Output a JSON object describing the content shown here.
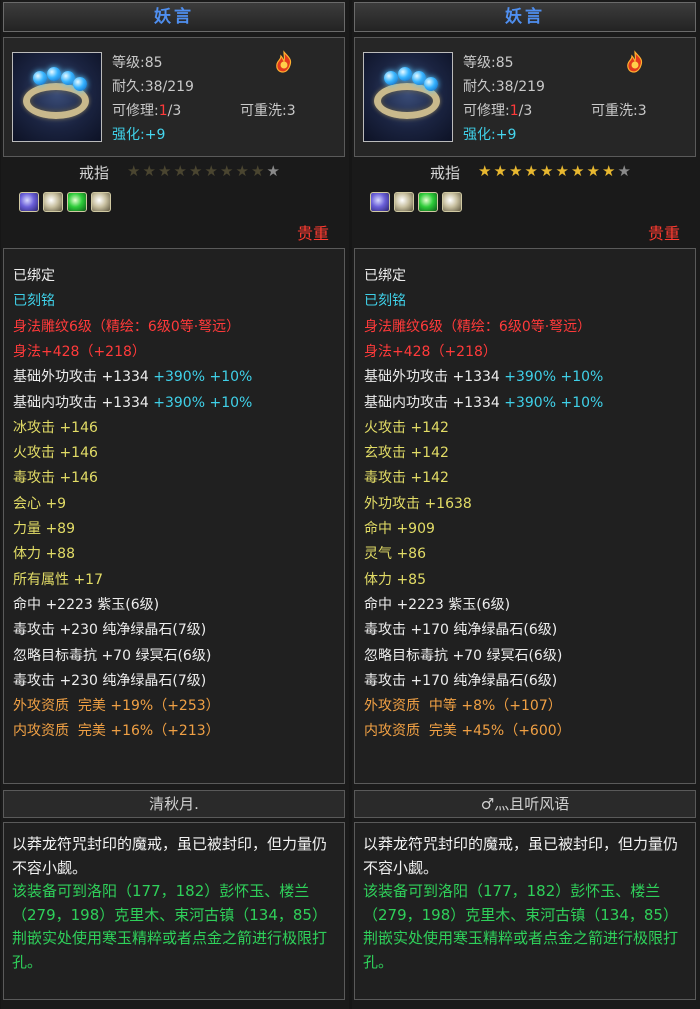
{
  "colors": {
    "title_blue": "#4f8ff0",
    "red": "#ff3a3a",
    "cyan": "#3fd0e8",
    "yellow": "#e2dc66",
    "orange": "#f0a044",
    "white": "#ededed",
    "green": "#2fd05a"
  },
  "panels": [
    {
      "title": "妖言",
      "level": "等级:85",
      "durability": "耐久:38/219",
      "repair_label": "可修理:",
      "repair_used": "1",
      "repair_total": "/3",
      "reset": "可重洗:3",
      "enhance_label": "强化:",
      "enhance_value": "+9",
      "type_name": "戒指",
      "stars_filled": 0,
      "stars_total": 10,
      "gem_slots": [
        "purple-gem-icon",
        "white-gem-icon",
        "green-gem-icon",
        "white-gem-icon"
      ],
      "quality": "贵重",
      "attributes": [
        {
          "segments": [
            {
              "t": "已绑定",
              "c": "white"
            }
          ]
        },
        {
          "segments": [
            {
              "t": "已刻铭",
              "c": "cyan"
            }
          ]
        },
        {
          "segments": [
            {
              "t": "身法雕纹6级（精绘：6级0等·弩远）",
              "c": "red"
            }
          ]
        },
        {
          "segments": [
            {
              "t": "身法+428（+218）",
              "c": "red"
            }
          ]
        },
        {
          "segments": [
            {
              "t": "基础外功攻击 +1334 ",
              "c": "white"
            },
            {
              "t": "+390% +10%",
              "c": "cyan"
            }
          ]
        },
        {
          "segments": [
            {
              "t": "基础内功攻击 +1334 ",
              "c": "white"
            },
            {
              "t": "+390% +10%",
              "c": "cyan"
            }
          ]
        },
        {
          "segments": [
            {
              "t": "冰攻击 +146",
              "c": "yellow"
            }
          ]
        },
        {
          "segments": [
            {
              "t": "火攻击 +146",
              "c": "yellow"
            }
          ]
        },
        {
          "segments": [
            {
              "t": "毒攻击 +146",
              "c": "yellow"
            }
          ]
        },
        {
          "segments": [
            {
              "t": "会心 +9",
              "c": "yellow"
            }
          ]
        },
        {
          "segments": [
            {
              "t": "力量 +89",
              "c": "yellow"
            }
          ]
        },
        {
          "segments": [
            {
              "t": "体力 +88",
              "c": "yellow"
            }
          ]
        },
        {
          "segments": [
            {
              "t": "所有属性 +17",
              "c": "yellow"
            }
          ]
        },
        {
          "segments": [
            {
              "t": "命中 +2223 紫玉(6级)",
              "c": "white"
            }
          ]
        },
        {
          "segments": [
            {
              "t": "毒攻击 +230 纯净绿晶石(7级)",
              "c": "white"
            }
          ]
        },
        {
          "segments": [
            {
              "t": "忽略目标毒抗 +70 绿冥石(6级)",
              "c": "white"
            }
          ]
        },
        {
          "segments": [
            {
              "t": "毒攻击 +230 纯净绿晶石(7级)",
              "c": "white"
            }
          ]
        },
        {
          "segments": [
            {
              "t": "外攻资质  完美 +19%（+253）",
              "c": "orange"
            }
          ]
        },
        {
          "segments": [
            {
              "t": "内攻资质  完美 +16%（+213）",
              "c": "orange"
            }
          ]
        }
      ],
      "owner": "清秋月.",
      "desc_white": "以莽龙符咒封印的魔戒，虽已被封印，但力量仍不容小觑。",
      "desc_green": "该装备可到洛阳（177，182）彭怀玉、楼兰（279，198）克里木、束河古镇（134，85）荆嵌实处使用寒玉精粹或者点金之箭进行极限打孔。"
    },
    {
      "title": "妖言",
      "level": "等级:85",
      "durability": "耐久:38/219",
      "repair_label": "可修理:",
      "repair_used": "1",
      "repair_total": "/3",
      "reset": "可重洗:3",
      "enhance_label": "强化:",
      "enhance_value": "+9",
      "type_name": "戒指",
      "stars_filled": 9,
      "stars_total": 10,
      "gem_slots": [
        "purple-gem-icon",
        "white-gem-icon",
        "green-gem-icon",
        "white-gem-icon"
      ],
      "quality": "贵重",
      "attributes": [
        {
          "segments": [
            {
              "t": "已绑定",
              "c": "white"
            }
          ]
        },
        {
          "segments": [
            {
              "t": "已刻铭",
              "c": "cyan"
            }
          ]
        },
        {
          "segments": [
            {
              "t": "身法雕纹6级（精绘：6级0等·弩远）",
              "c": "red"
            }
          ]
        },
        {
          "segments": [
            {
              "t": "身法+428（+218）",
              "c": "red"
            }
          ]
        },
        {
          "segments": [
            {
              "t": "基础外功攻击 +1334 ",
              "c": "white"
            },
            {
              "t": "+390% +10%",
              "c": "cyan"
            }
          ]
        },
        {
          "segments": [
            {
              "t": "基础内功攻击 +1334 ",
              "c": "white"
            },
            {
              "t": "+390% +10%",
              "c": "cyan"
            }
          ]
        },
        {
          "segments": [
            {
              "t": "火攻击 +142",
              "c": "yellow"
            }
          ]
        },
        {
          "segments": [
            {
              "t": "玄攻击 +142",
              "c": "yellow"
            }
          ]
        },
        {
          "segments": [
            {
              "t": "毒攻击 +142",
              "c": "yellow"
            }
          ]
        },
        {
          "segments": [
            {
              "t": "外功攻击 +1638",
              "c": "yellow"
            }
          ]
        },
        {
          "segments": [
            {
              "t": "命中 +909",
              "c": "yellow"
            }
          ]
        },
        {
          "segments": [
            {
              "t": "灵气 +86",
              "c": "yellow"
            }
          ]
        },
        {
          "segments": [
            {
              "t": "体力 +85",
              "c": "yellow"
            }
          ]
        },
        {
          "segments": [
            {
              "t": "命中 +2223 紫玉(6级)",
              "c": "white"
            }
          ]
        },
        {
          "segments": [
            {
              "t": "毒攻击 +170 纯净绿晶石(6级)",
              "c": "white"
            }
          ]
        },
        {
          "segments": [
            {
              "t": "忽略目标毒抗 +70 绿冥石(6级)",
              "c": "white"
            }
          ]
        },
        {
          "segments": [
            {
              "t": "毒攻击 +170 纯净绿晶石(6级)",
              "c": "white"
            }
          ]
        },
        {
          "segments": [
            {
              "t": "外攻资质  中等 +8%（+107）",
              "c": "orange"
            }
          ]
        },
        {
          "segments": [
            {
              "t": "内攻资质  完美 +45%（+600）",
              "c": "orange"
            }
          ]
        }
      ],
      "owner": "♂灬且听风语",
      "desc_white": "以莽龙符咒封印的魔戒，虽已被封印，但力量仍不容小觑。",
      "desc_green": "该装备可到洛阳（177，182）彭怀玉、楼兰（279，198）克里木、束河古镇（134，85）荆嵌实处使用寒玉精粹或者点金之箭进行极限打孔。"
    }
  ]
}
